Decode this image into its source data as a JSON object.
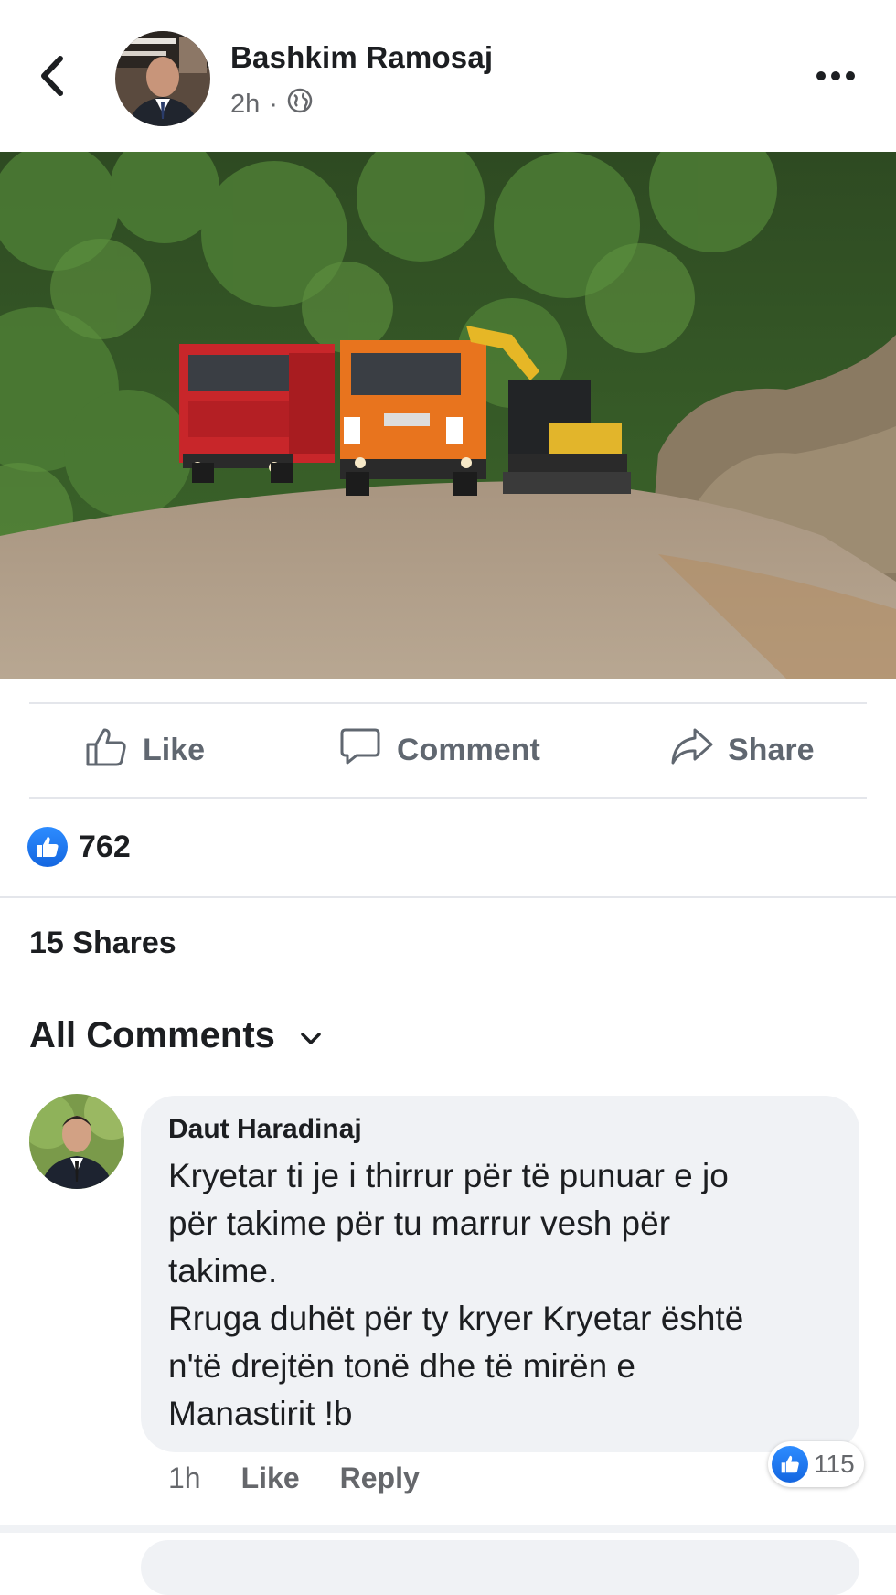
{
  "post": {
    "author": "Bashkim Ramosaj",
    "time": "2h",
    "privacy_icon": "globe-icon"
  },
  "actions": {
    "like_label": "Like",
    "comment_label": "Comment",
    "share_label": "Share"
  },
  "stats": {
    "likes_count": "762",
    "shares_label": "15 Shares"
  },
  "comments_filter": {
    "label": "All Comments"
  },
  "comments": [
    {
      "author": "Daut Haradinaj",
      "text": "Kryetar ti je i thirrur për të punuar e jo\npër takime për tu marrur vesh për\ntakime.\nRruga duhët për ty kryer Kryetar është\nn'të drejtën tonë dhe të mirën e\nManastirit !b",
      "time": "1h",
      "like_label": "Like",
      "reply_label": "Reply",
      "reaction_count": "115"
    }
  ],
  "colors": {
    "accent": "#1877f2",
    "text": "#1c1e21",
    "muted": "#65676b",
    "bubble": "#f0f2f5"
  }
}
